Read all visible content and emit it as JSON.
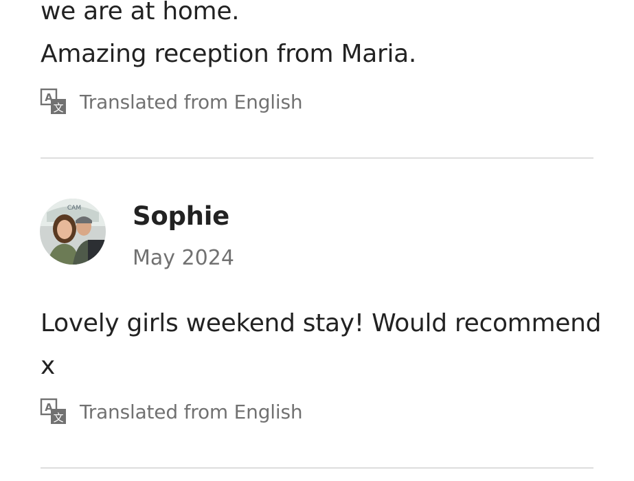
{
  "previous_review": {
    "lines": [
      "we are at home.",
      "Amazing reception from Maria."
    ],
    "translation_note": "Translated from English"
  },
  "review": {
    "reviewer_name": "Sophie",
    "date": "May 2024",
    "text": "Lovely girls weekend stay! Would recommend x",
    "translation_note": "Translated from English"
  },
  "icons": {
    "translate": "translate-icon",
    "avatar": "avatar"
  },
  "colors": {
    "primary_text": "#222222",
    "secondary_text": "#717171",
    "divider": "#dddddd"
  }
}
